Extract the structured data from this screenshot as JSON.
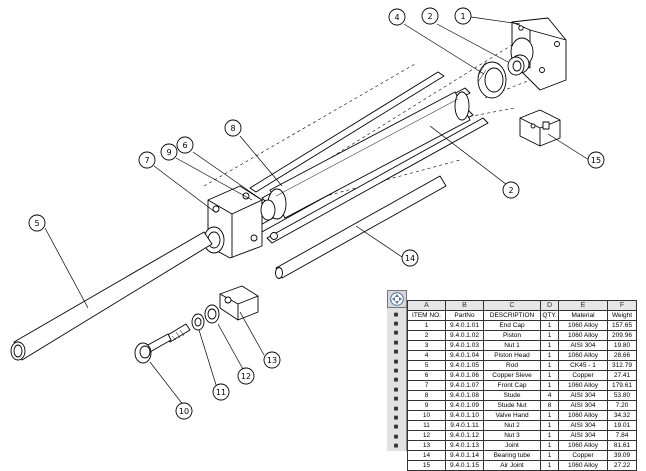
{
  "balloons": [
    {
      "id": "balloon-1",
      "label": "1"
    },
    {
      "id": "balloon-2-top",
      "label": "2"
    },
    {
      "id": "balloon-4",
      "label": "4"
    },
    {
      "id": "balloon-8",
      "label": "8"
    },
    {
      "id": "balloon-6",
      "label": "6"
    },
    {
      "id": "balloon-9",
      "label": "9"
    },
    {
      "id": "balloon-7",
      "label": "7"
    },
    {
      "id": "balloon-5",
      "label": "5"
    },
    {
      "id": "balloon-2-mid",
      "label": "2"
    },
    {
      "id": "balloon-15",
      "label": "15"
    },
    {
      "id": "balloon-14",
      "label": "14"
    },
    {
      "id": "balloon-13",
      "label": "13"
    },
    {
      "id": "balloon-12",
      "label": "12"
    },
    {
      "id": "balloon-11",
      "label": "11"
    },
    {
      "id": "balloon-10",
      "label": "10"
    }
  ],
  "bom": {
    "column_letters": [
      "A",
      "B",
      "C",
      "D",
      "E",
      "F"
    ],
    "headers": [
      "ITEM NO.",
      "PartNo",
      "DESCRIPTION",
      "QTY.",
      "Material",
      "Weight"
    ],
    "rows": [
      [
        "1",
        "9.4.0.1.01",
        "End Cap",
        "1",
        "1060 Alloy",
        "157.65"
      ],
      [
        "2",
        "9.4.0.1.02",
        "Piston",
        "1",
        "1060 Alloy",
        "209.96"
      ],
      [
        "3",
        "9.4.0.1.03",
        "Nut 1",
        "1",
        "AISI 304",
        "19.80"
      ],
      [
        "4",
        "9.4.0.1.04",
        "Piston Head",
        "1",
        "1060 Alloy",
        "28.66"
      ],
      [
        "5",
        "9.4.0.1.05",
        "Rod",
        "1",
        "CK45 - 1",
        "312.79"
      ],
      [
        "6",
        "9.4.0.1.06",
        "Copper Sleve",
        "1",
        "Copper",
        "27.41"
      ],
      [
        "7",
        "9.4.0.1.07",
        "Front Cap",
        "1",
        "1060 Alloy",
        "179.61"
      ],
      [
        "8",
        "9.4.0.1.08",
        "Stude",
        "4",
        "AISI 304",
        "53.80"
      ],
      [
        "9",
        "9.4.0.1.09",
        "Stude Nut",
        "8",
        "AISI 304",
        "7.20"
      ],
      [
        "10",
        "9.4.0.1.10",
        "Valve Hand",
        "1",
        "1060 Alloy",
        "34.32"
      ],
      [
        "11",
        "9.4.0.1.11",
        "Nut 2",
        "1",
        "AISI 304",
        "19.01"
      ],
      [
        "12",
        "9.4.0.1.12",
        "Nut 3",
        "1",
        "AISI 304",
        "7.84"
      ],
      [
        "13",
        "9.4.0.1.13",
        "Joint",
        "1",
        "1060 Alloy",
        "81.61"
      ],
      [
        "14",
        "9.4.0.1.14",
        "Bearing tube",
        "1",
        "Copper",
        "39.09"
      ],
      [
        "15",
        "9.4.0.1.15",
        "Air Joint",
        "1",
        "1060 Alloy",
        "27.22"
      ]
    ]
  }
}
